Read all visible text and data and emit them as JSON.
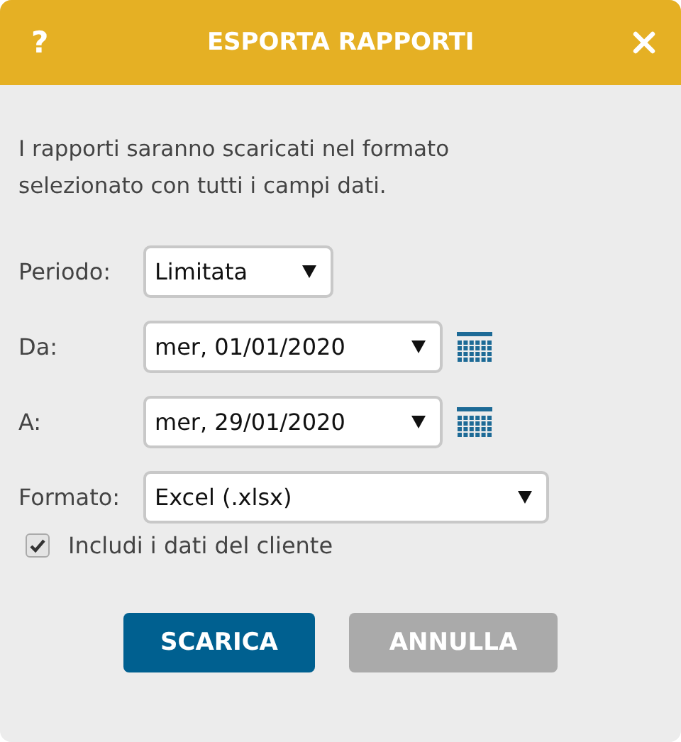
{
  "dialog": {
    "title": "ESPORTA RAPPORTI",
    "help": "?"
  },
  "description": "I rapporti saranno scaricati nel formato selezionato con tutti i campi dati.",
  "fields": [
    {
      "label": "Periodo:",
      "value": "Limitata",
      "kind": "select"
    },
    {
      "label": "Da:",
      "value": "mer, 01/01/2020",
      "kind": "date"
    },
    {
      "label": "A:",
      "value": "mer, 29/01/2020",
      "kind": "date"
    },
    {
      "label": "Formato:",
      "value": "Excel (.xlsx)",
      "kind": "select"
    }
  ],
  "checkbox": {
    "label": "Includi i dati del cliente",
    "checked": true
  },
  "buttons": [
    {
      "label": "SCARICA",
      "disabled": false
    },
    {
      "label": "ANNULLA",
      "disabled": true
    }
  ]
}
